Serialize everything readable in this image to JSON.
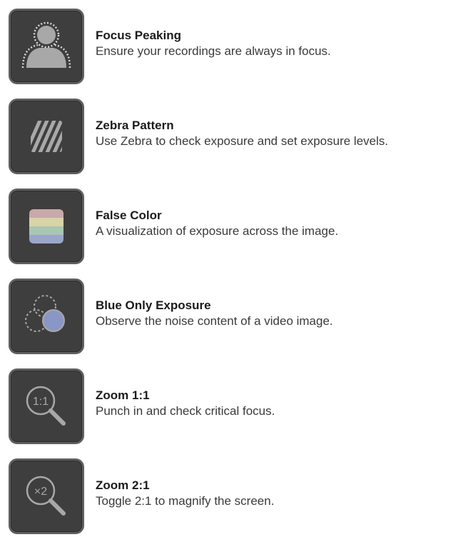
{
  "features": [
    {
      "icon": "focus-peaking-icon",
      "title": "Focus Peaking",
      "description": "Ensure your recordings are always in focus."
    },
    {
      "icon": "zebra-pattern-icon",
      "title": "Zebra Pattern",
      "description": "Use Zebra to check exposure and set exposure levels."
    },
    {
      "icon": "false-color-icon",
      "title": "False Color",
      "description": "A visualization of exposure across the image."
    },
    {
      "icon": "blue-only-exposure-icon",
      "title": "Blue Only Exposure",
      "description": "Observe the noise content of a video image."
    },
    {
      "icon": "zoom-1-1-icon",
      "title": "Zoom 1:1",
      "description": "Punch in and check critical focus.",
      "icon_text": "1:1"
    },
    {
      "icon": "zoom-2-1-icon",
      "title": "Zoom 2:1",
      "description": "Toggle 2:1 to magnify the screen.",
      "icon_text": "×2"
    }
  ],
  "colors": {
    "tile_background": "#3e3e3e",
    "tile_border": "#5f5f5f",
    "icon_gray": "#a8a8a8",
    "false_color_bands": [
      "#c9a9ab",
      "#d7d4a5",
      "#a9c6b2",
      "#9ba6cb"
    ],
    "blue_fill": "#8a97c4"
  }
}
